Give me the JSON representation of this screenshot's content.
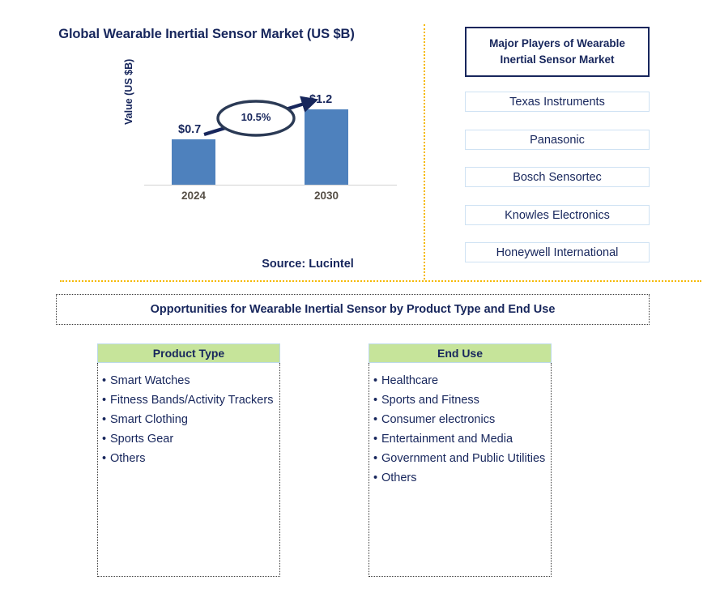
{
  "chart_panel": {
    "title": "Global Wearable Inertial Sensor Market (US $B)",
    "y_axis_label": "Value (US $B)",
    "source": "Source: Lucintel"
  },
  "chart_data": {
    "type": "bar",
    "title": "Global Wearable Inertial Sensor Market (US $B)",
    "xlabel": "",
    "ylabel": "Value (US $B)",
    "categories": [
      "2024",
      "2030"
    ],
    "values": [
      0.7,
      1.2
    ],
    "value_labels": [
      "$0.7",
      "$1.2"
    ],
    "ylim": [
      0,
      1.45
    ],
    "grid": false,
    "legend": "none",
    "bar_color": "#4e81bd",
    "annotation": {
      "label": "10.5%",
      "meaning": "CAGR from 2024 to 2030",
      "shape": "ellipse-with-arrow"
    },
    "source": "Source: Lucintel"
  },
  "players": {
    "header": "Major Players of Wearable Inertial Sensor Market",
    "items": [
      "Texas Instruments",
      "Panasonic",
      "Bosch Sensortec",
      "Knowles Electronics",
      "Honeywell International"
    ]
  },
  "opportunities": {
    "banner": "Opportunities for Wearable Inertial Sensor by Product Type and End Use",
    "columns": [
      {
        "header": "Product Type",
        "items": [
          "Smart Watches",
          "Fitness Bands/Activity Trackers",
          "Smart Clothing",
          "Sports Gear",
          "Others"
        ]
      },
      {
        "header": "End Use",
        "items": [
          "Healthcare",
          "Sports and Fitness",
          "Consumer electronics",
          "Entertainment and Media",
          "Government and Public Utilities",
          "Others"
        ]
      }
    ]
  },
  "colors": {
    "navy": "#17265c",
    "bar_blue": "#4e81bd",
    "divider_gold": "#f5b800",
    "header_green": "#c6e49a",
    "player_border": "#cfe2f3"
  }
}
